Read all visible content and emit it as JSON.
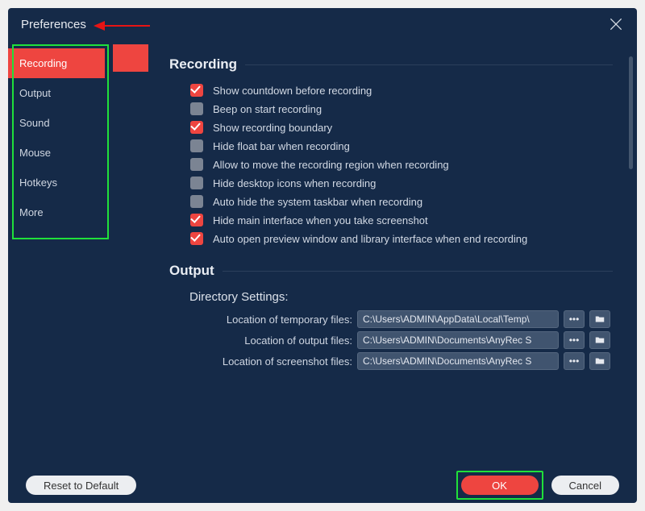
{
  "titlebar": {
    "title": "Preferences"
  },
  "sidebar": {
    "items": [
      {
        "label": "Recording",
        "active": true
      },
      {
        "label": "Output",
        "active": false
      },
      {
        "label": "Sound",
        "active": false
      },
      {
        "label": "Mouse",
        "active": false
      },
      {
        "label": "Hotkeys",
        "active": false
      },
      {
        "label": "More",
        "active": false
      }
    ]
  },
  "main": {
    "recording": {
      "heading": "Recording",
      "options": [
        {
          "label": "Show countdown before recording",
          "checked": true
        },
        {
          "label": "Beep on start recording",
          "checked": false
        },
        {
          "label": "Show recording boundary",
          "checked": true
        },
        {
          "label": "Hide float bar when recording",
          "checked": false
        },
        {
          "label": "Allow to move the recording region when recording",
          "checked": false
        },
        {
          "label": "Hide desktop icons when recording",
          "checked": false
        },
        {
          "label": "Auto hide the system taskbar when recording",
          "checked": false
        },
        {
          "label": "Hide main interface when you take screenshot",
          "checked": true
        },
        {
          "label": "Auto open preview window and library interface when end recording",
          "checked": true
        }
      ]
    },
    "output": {
      "heading": "Output",
      "subheading": "Directory Settings:",
      "rows": [
        {
          "label": "Location of temporary files:",
          "value": "C:\\Users\\ADMIN\\AppData\\Local\\Temp\\"
        },
        {
          "label": "Location of output files:",
          "value": "C:\\Users\\ADMIN\\Documents\\AnyRec S"
        },
        {
          "label": "Location of screenshot files:",
          "value": "C:\\Users\\ADMIN\\Documents\\AnyRec S"
        }
      ]
    }
  },
  "footer": {
    "reset_label": "Reset to Default",
    "ok_label": "OK",
    "cancel_label": "Cancel"
  },
  "colors": {
    "accent": "#ee4540",
    "highlight_box": "#20e03a",
    "bg": "#152a48"
  }
}
